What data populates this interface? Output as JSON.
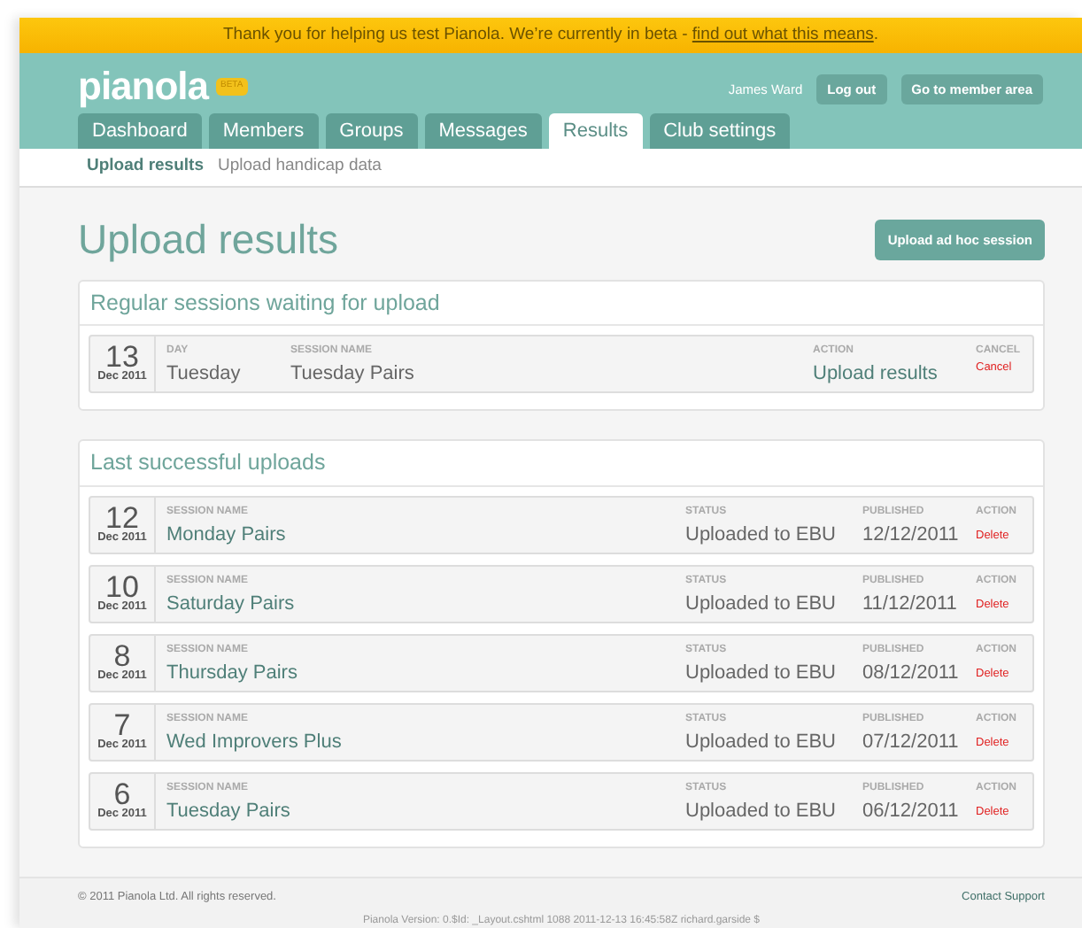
{
  "banner": {
    "text": "Thank you for helping us test Pianola. We’re currently in beta - ",
    "link": "find out what this means",
    "suffix": "."
  },
  "header": {
    "logo": "pianola",
    "badge": "BETA",
    "user": "James Ward",
    "buttons": [
      "Log out",
      "Go to member area"
    ]
  },
  "tabs": [
    {
      "label": "Dashboard",
      "selected": false
    },
    {
      "label": "Members",
      "selected": false
    },
    {
      "label": "Groups",
      "selected": false
    },
    {
      "label": "Messages",
      "selected": false
    },
    {
      "label": "Results",
      "selected": true
    },
    {
      "label": "Club settings",
      "selected": false
    }
  ],
  "subnav": [
    {
      "label": "Upload results",
      "selected": true
    },
    {
      "label": "Upload handicap data",
      "selected": false
    }
  ],
  "page_title": "Upload results",
  "ad_hoc_button": "Upload ad hoc session",
  "waiting": {
    "title": "Regular sessions waiting for upload",
    "rows": [
      {
        "day_num": "13",
        "month": "Dec 2011",
        "day_label": "DAY",
        "day": "Tuesday",
        "name_label": "SESSION NAME",
        "name": "Tuesday Pairs",
        "action_label": "ACTION",
        "action": "Upload results",
        "cancel_label": "CANCEL",
        "cancel": "Cancel"
      }
    ]
  },
  "uploads": {
    "title": "Last successful uploads",
    "rows": [
      {
        "day_num": "12",
        "month": "Dec 2011",
        "name_label": "SESSION NAME",
        "name": "Monday Pairs",
        "status_label": "STATUS",
        "status": "Uploaded to EBU",
        "published_label": "PUBLISHED",
        "published": "12/12/2011",
        "action_label": "ACTION",
        "action": "Delete"
      },
      {
        "day_num": "10",
        "month": "Dec 2011",
        "name_label": "SESSION NAME",
        "name": "Saturday Pairs",
        "status_label": "STATUS",
        "status": "Uploaded to EBU",
        "published_label": "PUBLISHED",
        "published": "11/12/2011",
        "action_label": "ACTION",
        "action": "Delete"
      },
      {
        "day_num": "8",
        "month": "Dec 2011",
        "name_label": "SESSION NAME",
        "name": "Thursday Pairs",
        "status_label": "STATUS",
        "status": "Uploaded to EBU",
        "published_label": "PUBLISHED",
        "published": "08/12/2011",
        "action_label": "ACTION",
        "action": "Delete"
      },
      {
        "day_num": "7",
        "month": "Dec 2011",
        "name_label": "SESSION NAME",
        "name": "Wed Improvers Plus",
        "status_label": "STATUS",
        "status": "Uploaded to EBU",
        "published_label": "PUBLISHED",
        "published": "07/12/2011",
        "action_label": "ACTION",
        "action": "Delete"
      },
      {
        "day_num": "6",
        "month": "Dec 2011",
        "name_label": "SESSION NAME",
        "name": "Tuesday Pairs",
        "status_label": "STATUS",
        "status": "Uploaded to EBU",
        "published_label": "PUBLISHED",
        "published": "06/12/2011",
        "action_label": "ACTION",
        "action": "Delete"
      }
    ]
  },
  "footer": {
    "copyright": "© 2011 Pianola Ltd. All rights reserved.",
    "support": "Contact Support",
    "version": "Pianola Version: 0.$Id: _Layout.cshtml 1088 2011-12-13 16:45:58Z richard.garside $"
  }
}
